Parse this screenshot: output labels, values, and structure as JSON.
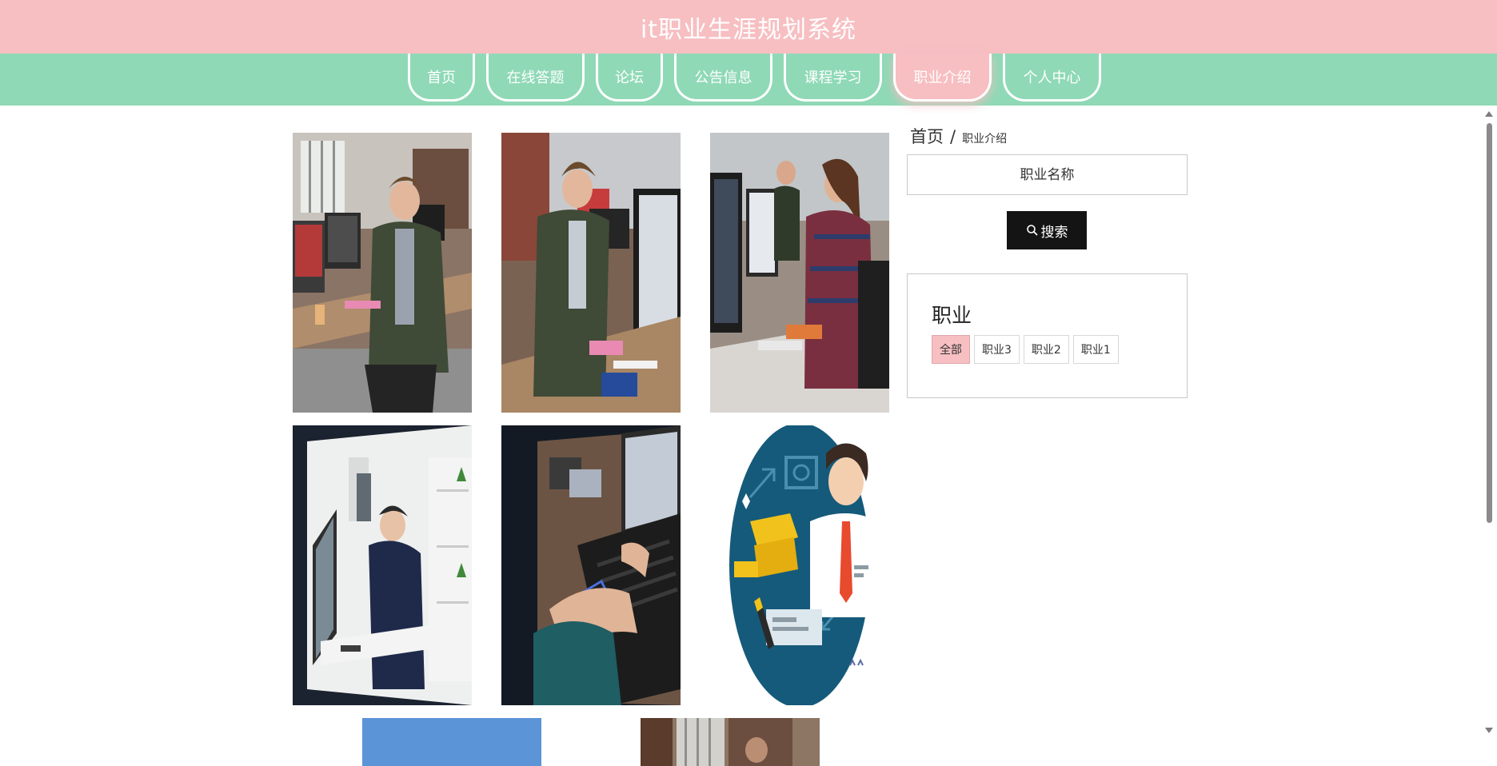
{
  "header": {
    "title": "it职业生涯规划系统"
  },
  "nav": {
    "items": [
      {
        "label": "首页"
      },
      {
        "label": "在线答题"
      },
      {
        "label": "论坛"
      },
      {
        "label": "公告信息"
      },
      {
        "label": "课程学习"
      },
      {
        "label": "职业介绍",
        "active": true
      },
      {
        "label": "个人中心"
      }
    ]
  },
  "breadcrumb": {
    "home": "首页",
    "separator": "/",
    "current": "职业介绍"
  },
  "search": {
    "placeholder": "职业名称",
    "button_label": "搜索",
    "button_icon": "search-icon"
  },
  "filter": {
    "title": "职业",
    "tags": [
      {
        "label": "全部",
        "active": true
      },
      {
        "label": "职业3"
      },
      {
        "label": "职业2"
      },
      {
        "label": "职业1"
      }
    ]
  },
  "cards": [
    {
      "image": "office-man-smiling-at-desk"
    },
    {
      "image": "office-man-thinking-near-monitor"
    },
    {
      "image": "office-woman-working-at-computer"
    },
    {
      "image": "man-working-at-white-desk"
    },
    {
      "image": "hands-typing-on-laptop"
    },
    {
      "image": "businessman-illustration-circle"
    },
    {
      "image": "blue-placeholder"
    },
    {
      "image": "office-photo-partial"
    }
  ],
  "colors": {
    "header_pink": "#f7bfc2",
    "nav_green": "#8fd9b6",
    "button_black": "#141414"
  }
}
